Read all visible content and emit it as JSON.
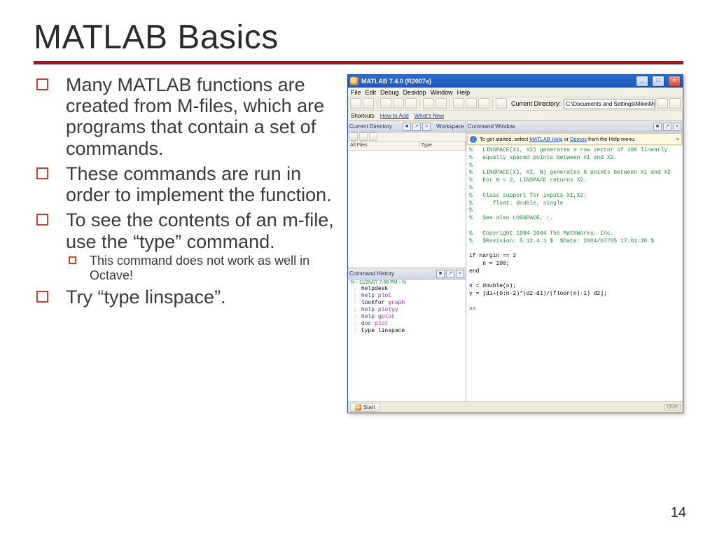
{
  "slide": {
    "title": "MATLAB Basics",
    "page_number": "14",
    "bullets": [
      "Many MATLAB functions are created from M-files, which are programs that contain a set of commands.",
      "These commands are run in order to implement the function.",
      "To see the contents of an m-file, use the “type” command.",
      "Try “type linspace”."
    ],
    "sub_bullet": "This command does not work as well in Octave!"
  },
  "matlab": {
    "window_title": "MATLAB 7.4.0 (R2007a)",
    "menu": [
      "File",
      "Edit",
      "Debug",
      "Desktop",
      "Window",
      "Help"
    ],
    "current_directory_path": "C:\\Documents and Settings\\Mike\\My Documents\\MATLAB",
    "shortcuts": {
      "label": "Shortcuts",
      "how_to_add": "How to Add",
      "whats_new": "What's New"
    },
    "dir_panel": {
      "title": "Current Directory",
      "cols": {
        "all_files": "All Files",
        "type": "Type"
      },
      "tab_workspace": "Workspace"
    },
    "hist_panel": {
      "title": "Command History",
      "session": "%-- 11/25/07  7:08 PM --%",
      "items": [
        {
          "plain": "helpdesk"
        },
        {
          "kw": "help",
          "arg": "plot"
        },
        {
          "plain": "lookfor",
          "arg_plain": "graph"
        },
        {
          "kw": "help",
          "arg": "plotyy"
        },
        {
          "kw": "help",
          "arg": "gplot"
        },
        {
          "kw": "doc",
          "arg": "plot"
        },
        {
          "plain": "type linspace"
        }
      ]
    },
    "cmd_panel": {
      "title": "Command Window",
      "hint_prefix": "To get started, select ",
      "hint_link1": "MATLAB Help",
      "hint_mid": " or ",
      "hint_link2": "Demos",
      "hint_suffix": " from the Help menu.",
      "lines": [
        "%   LINSPACE(X1, X2) generates a row vector of 100 linearly",
        "%   equally spaced points between X1 and X2.",
        "%",
        "%   LINSPACE(X1, X2, N) generates N points between X1 and X2",
        "%   For N < 2, LINSPACE returns X2.",
        "%",
        "%   Class support for inputs X1,X2:",
        "%      float: double, single",
        "%",
        "%   See also LOGSPACE, :.",
        "",
        "%   Copyright 1984-2004 The MathWorks, Inc.",
        "%   $Revision: 5.12.4.1 $  $Date: 2004/07/05 17:01:20 $",
        "",
        "if nargin == 2",
        "    n = 100;",
        "end",
        "",
        "n = double(n);",
        "y = [d1+(0:n-2)*(d2-d1)/(floor(n)-1) d2];",
        "",
        ">>"
      ]
    },
    "start_label": "Start",
    "ovr_label": "OVR"
  }
}
